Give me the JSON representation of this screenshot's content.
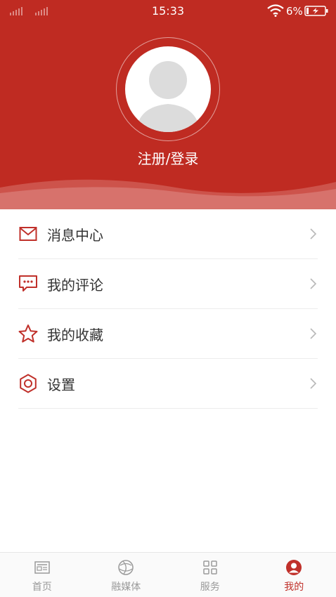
{
  "status_bar": {
    "time": "15:33",
    "battery_percent": "6%"
  },
  "profile": {
    "login_label": "注册/登录"
  },
  "menu": {
    "items": [
      {
        "label": "消息中心",
        "icon": "mail-icon"
      },
      {
        "label": "我的评论",
        "icon": "comment-icon"
      },
      {
        "label": "我的收藏",
        "icon": "star-icon"
      },
      {
        "label": "设置",
        "icon": "gear-icon"
      }
    ]
  },
  "tabbar": {
    "tabs": [
      {
        "label": "首页",
        "icon": "news-icon",
        "active": false
      },
      {
        "label": "融媒体",
        "icon": "globe-icon",
        "active": false
      },
      {
        "label": "服务",
        "icon": "grid-icon",
        "active": false
      },
      {
        "label": "我的",
        "icon": "user-icon",
        "active": true
      }
    ]
  },
  "colors": {
    "accent": "#bf2b22",
    "tab_active": "#c0302a",
    "tab_inactive": "#9a9a9a"
  }
}
